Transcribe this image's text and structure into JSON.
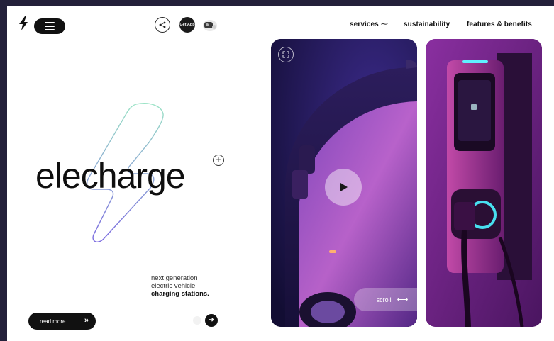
{
  "header": {
    "get_app_label": "Get App",
    "nav": [
      {
        "label": "services",
        "arrow": "⁓"
      },
      {
        "label": "sustainability"
      },
      {
        "label": "features & benefits"
      }
    ]
  },
  "hero": {
    "brand": "elecharge",
    "tagline_line1": "next generation",
    "tagline_line2": "electric vehicle",
    "tagline_line3": "charging stations.",
    "read_more_label": "read more",
    "read_more_chevrons": "»",
    "next_arrow": "➜"
  },
  "media": {
    "scroll_label": "scroll",
    "scroll_arrows": "⟷"
  },
  "icons": {
    "logo": "lightning-bolt-icon",
    "menu": "hamburger-icon",
    "share": "share-icon",
    "expand": "expand-icon",
    "play": "play-icon"
  },
  "colors": {
    "accent_dark": "#111111",
    "purple": "#6b2480",
    "background_frame": "#23203a"
  }
}
